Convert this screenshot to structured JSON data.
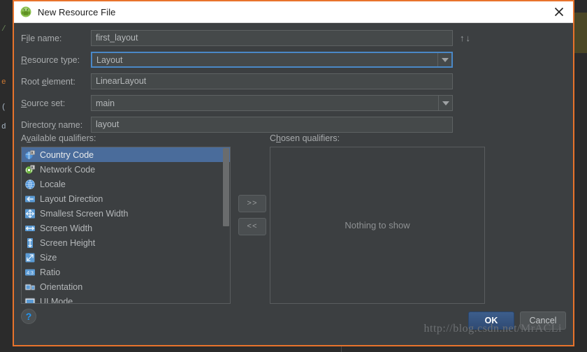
{
  "window": {
    "title": "New Resource File",
    "title_icon": "android-robot-icon",
    "close_icon": "close-icon",
    "border_color": "#e8732c"
  },
  "form": {
    "rows": [
      {
        "label_pre": "F",
        "label_mnemonic": "i",
        "label_post": "le name:",
        "label_full": "File name:",
        "type": "text",
        "value": "first_layout",
        "name": "file-name"
      },
      {
        "label_pre": "",
        "label_mnemonic": "R",
        "label_post": "esource type:",
        "label_full": "Resource type:",
        "type": "combo",
        "value": "Layout",
        "focused": true,
        "name": "resource-type"
      },
      {
        "label_pre": "Root ",
        "label_mnemonic": "e",
        "label_post": "lement:",
        "label_full": "Root element:",
        "type": "text",
        "value": "LinearLayout",
        "name": "root-element"
      },
      {
        "label_pre": "",
        "label_mnemonic": "S",
        "label_post": "ource set:",
        "label_full": "Source set:",
        "type": "combo",
        "value": "main",
        "focused": false,
        "name": "source-set"
      },
      {
        "label_pre": "Director",
        "label_mnemonic": "y",
        "label_post": " name:",
        "label_full": "Directory name:",
        "type": "text",
        "value": "layout",
        "name": "directory-name"
      }
    ],
    "sort_toggle": "↑↓",
    "sort_toggle_name": "sort-order-toggle"
  },
  "qualifiers": {
    "available_label_pre": "A",
    "available_label_mnemonic": "v",
    "available_label_post": "ailable qualifiers:",
    "available_label_full": "Available qualifiers:",
    "chosen_label_pre": "C",
    "chosen_label_mnemonic": "h",
    "chosen_label_post": "osen qualifiers:",
    "chosen_label_full": "Chosen qualifiers:",
    "available": [
      {
        "label": "Country Code",
        "icon": "country-code-icon",
        "selected": true
      },
      {
        "label": "Network Code",
        "icon": "network-code-icon",
        "selected": false
      },
      {
        "label": "Locale",
        "icon": "locale-globe-icon",
        "selected": false
      },
      {
        "label": "Layout Direction",
        "icon": "layout-direction-icon",
        "selected": false
      },
      {
        "label": "Smallest Screen Width",
        "icon": "smallest-screen-width-icon",
        "selected": false
      },
      {
        "label": "Screen Width",
        "icon": "screen-width-icon",
        "selected": false
      },
      {
        "label": "Screen Height",
        "icon": "screen-height-icon",
        "selected": false
      },
      {
        "label": "Size",
        "icon": "size-icon",
        "selected": false
      },
      {
        "label": "Ratio",
        "icon": "ratio-icon",
        "selected": false
      },
      {
        "label": "Orientation",
        "icon": "orientation-icon",
        "selected": false
      },
      {
        "label": "UI Mode",
        "icon": "ui-mode-icon",
        "selected": false
      }
    ],
    "chosen_empty_text": "Nothing to show",
    "move_right_label": ">>",
    "move_left_label": "<<",
    "selection_color": "#4a6c9b"
  },
  "footer": {
    "help_label": "?",
    "ok_label": "OK",
    "cancel_label": "Cancel",
    "ok_color": "#35537f"
  },
  "watermark": {
    "text": "http://blog.csdn.net/MrACLi"
  },
  "background": {
    "left_code": [
      "/",
      "e",
      "(",
      "d"
    ]
  }
}
